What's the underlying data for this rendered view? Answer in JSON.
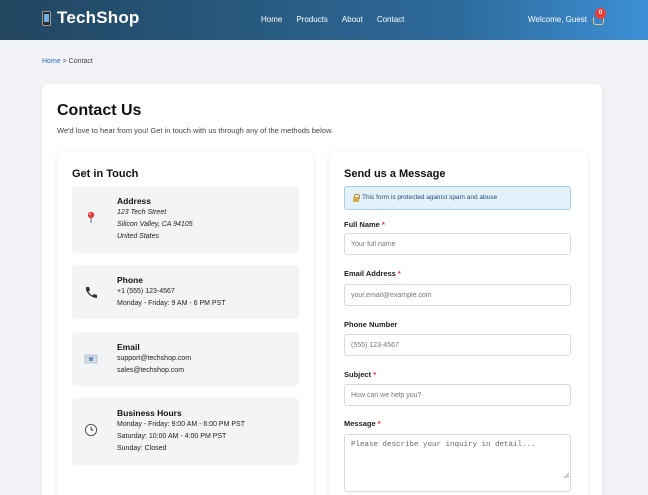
{
  "header": {
    "logo_text": "TechShop",
    "nav": [
      "Home",
      "Products",
      "About",
      "Contact"
    ],
    "welcome": "Welcome, Guest",
    "cart_count": "0"
  },
  "breadcrumb": {
    "home": "Home",
    "separator": " > ",
    "current": "Contact"
  },
  "page": {
    "title": "Contact Us",
    "subtitle": "We'd love to hear from you! Get in touch with us through any of the methods below."
  },
  "get_in_touch": {
    "title": "Get in Touch",
    "address": {
      "icon": "map-pin-icon",
      "title": "Address",
      "lines": [
        "123 Tech Street",
        "Silicon Valley, CA 94105",
        "United States"
      ]
    },
    "phone": {
      "icon": "phone-icon",
      "title": "Phone",
      "lines": [
        "+1 (555) 123-4567",
        "Monday - Friday: 9 AM - 6 PM PST"
      ]
    },
    "email": {
      "icon": "email-icon",
      "title": "Email",
      "lines": [
        "support@techshop.com",
        "sales@techshop.com"
      ]
    },
    "hours": {
      "icon": "clock-icon",
      "title": "Business Hours",
      "lines": [
        "Monday - Friday: 9:00 AM - 6:00 PM PST",
        "Saturday: 10:00 AM - 4:00 PM PST",
        "Sunday: Closed"
      ]
    }
  },
  "form": {
    "title": "Send us a Message",
    "security_note": "This form is protected against spam and abuse",
    "full_name": {
      "label": "Full Name",
      "required": "*",
      "placeholder": "Your full name"
    },
    "email": {
      "label": "Email Address",
      "required": "*",
      "placeholder": "your.email@example.com"
    },
    "phone": {
      "label": "Phone Number",
      "placeholder": "(555) 123-4567"
    },
    "subject": {
      "label": "Subject",
      "required": "*",
      "placeholder": "How can we help you?"
    },
    "message": {
      "label": "Message",
      "required": "*",
      "placeholder": "Please describe your inquiry in detail..."
    }
  },
  "colors": {
    "header_start": "#22455f",
    "header_end": "#3d8fd6",
    "link": "#2e6fbf",
    "required": "#e03131",
    "note_bg": "#e3f1fb"
  }
}
